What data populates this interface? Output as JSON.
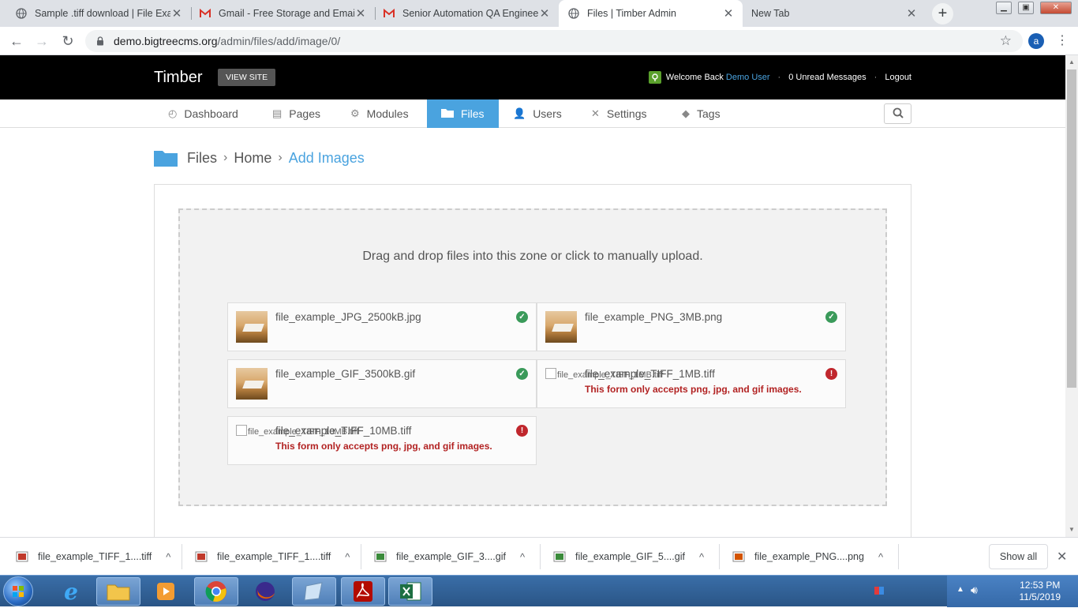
{
  "browser": {
    "tabs": [
      {
        "title": "Sample .tiff download | File Exam",
        "icon": "globe-icon"
      },
      {
        "title": "Gmail - Free Storage and Email",
        "icon": "gmail-icon"
      },
      {
        "title": "Senior Automation QA Engineer",
        "icon": "gmail-icon"
      },
      {
        "title": "Files | Timber Admin",
        "icon": "globe-icon"
      },
      {
        "title": "New Tab",
        "icon": ""
      }
    ],
    "url_host": "demo.bigtreecms.org",
    "url_path": "/admin/files/add/image/0/",
    "profile_initial": "a",
    "new_tab_glyph": "+",
    "tab_close_glyph": "✕"
  },
  "header": {
    "brand": "Timber",
    "view_site": "VIEW SITE",
    "welcome": "Welcome Back",
    "user": "Demo User",
    "messages": "0 Unread Messages",
    "logout": "Logout",
    "separator": "·"
  },
  "nav": {
    "items": [
      {
        "label": "Dashboard",
        "icon": "dashboard-icon"
      },
      {
        "label": "Pages",
        "icon": "pages-icon"
      },
      {
        "label": "Modules",
        "icon": "gear-icon"
      },
      {
        "label": "Files",
        "icon": "folder-icon",
        "active": true
      },
      {
        "label": "Users",
        "icon": "user-icon"
      },
      {
        "label": "Settings",
        "icon": "wrench-icon"
      },
      {
        "label": "Tags",
        "icon": "tag-icon"
      }
    ]
  },
  "breadcrumb": {
    "items": [
      "Files",
      "Home",
      "Add Images"
    ],
    "separator": "›"
  },
  "dropzone": {
    "message": "Drag and drop files into this zone or click to manually upload.",
    "files": [
      {
        "name": "file_example_JPG_2500kB.jpg",
        "status": "ok",
        "error": ""
      },
      {
        "name": "file_example_PNG_3MB.png",
        "status": "ok",
        "error": ""
      },
      {
        "name": "file_example_GIF_3500kB.gif",
        "status": "ok",
        "error": ""
      },
      {
        "name": "file_example_TIFF_1MB.tiff",
        "status": "error",
        "error": "This form only accepts png, jpg, and gif images.",
        "alt": "file_example_TIFF_1MB.tiff"
      },
      {
        "name": "file_example_TIFF_10MB.tiff",
        "status": "error",
        "error": "This form only accepts png, jpg, and gif images.",
        "alt": "file_example_TIFF_10MB.tiff"
      }
    ]
  },
  "downloads": {
    "items": [
      {
        "name": "file_example_TIFF_1....tiff"
      },
      {
        "name": "file_example_TIFF_1....tiff"
      },
      {
        "name": "file_example_GIF_3....gif"
      },
      {
        "name": "file_example_GIF_5....gif"
      },
      {
        "name": "file_example_PNG....png"
      }
    ],
    "show_all": "Show all",
    "chevron_glyph": "^",
    "close_glyph": "✕"
  },
  "taskbar": {
    "time": "12:53 PM",
    "date": "11/5/2019",
    "apps": [
      "start-orb",
      "internet-explorer",
      "file-explorer",
      "media-player",
      "chrome",
      "firefox",
      "app-window",
      "acrobat",
      "excel"
    ]
  },
  "colors": {
    "accent": "#4aa3df",
    "ok": "#3a9a5a",
    "error": "#c0272d",
    "header_bg": "#000000"
  }
}
